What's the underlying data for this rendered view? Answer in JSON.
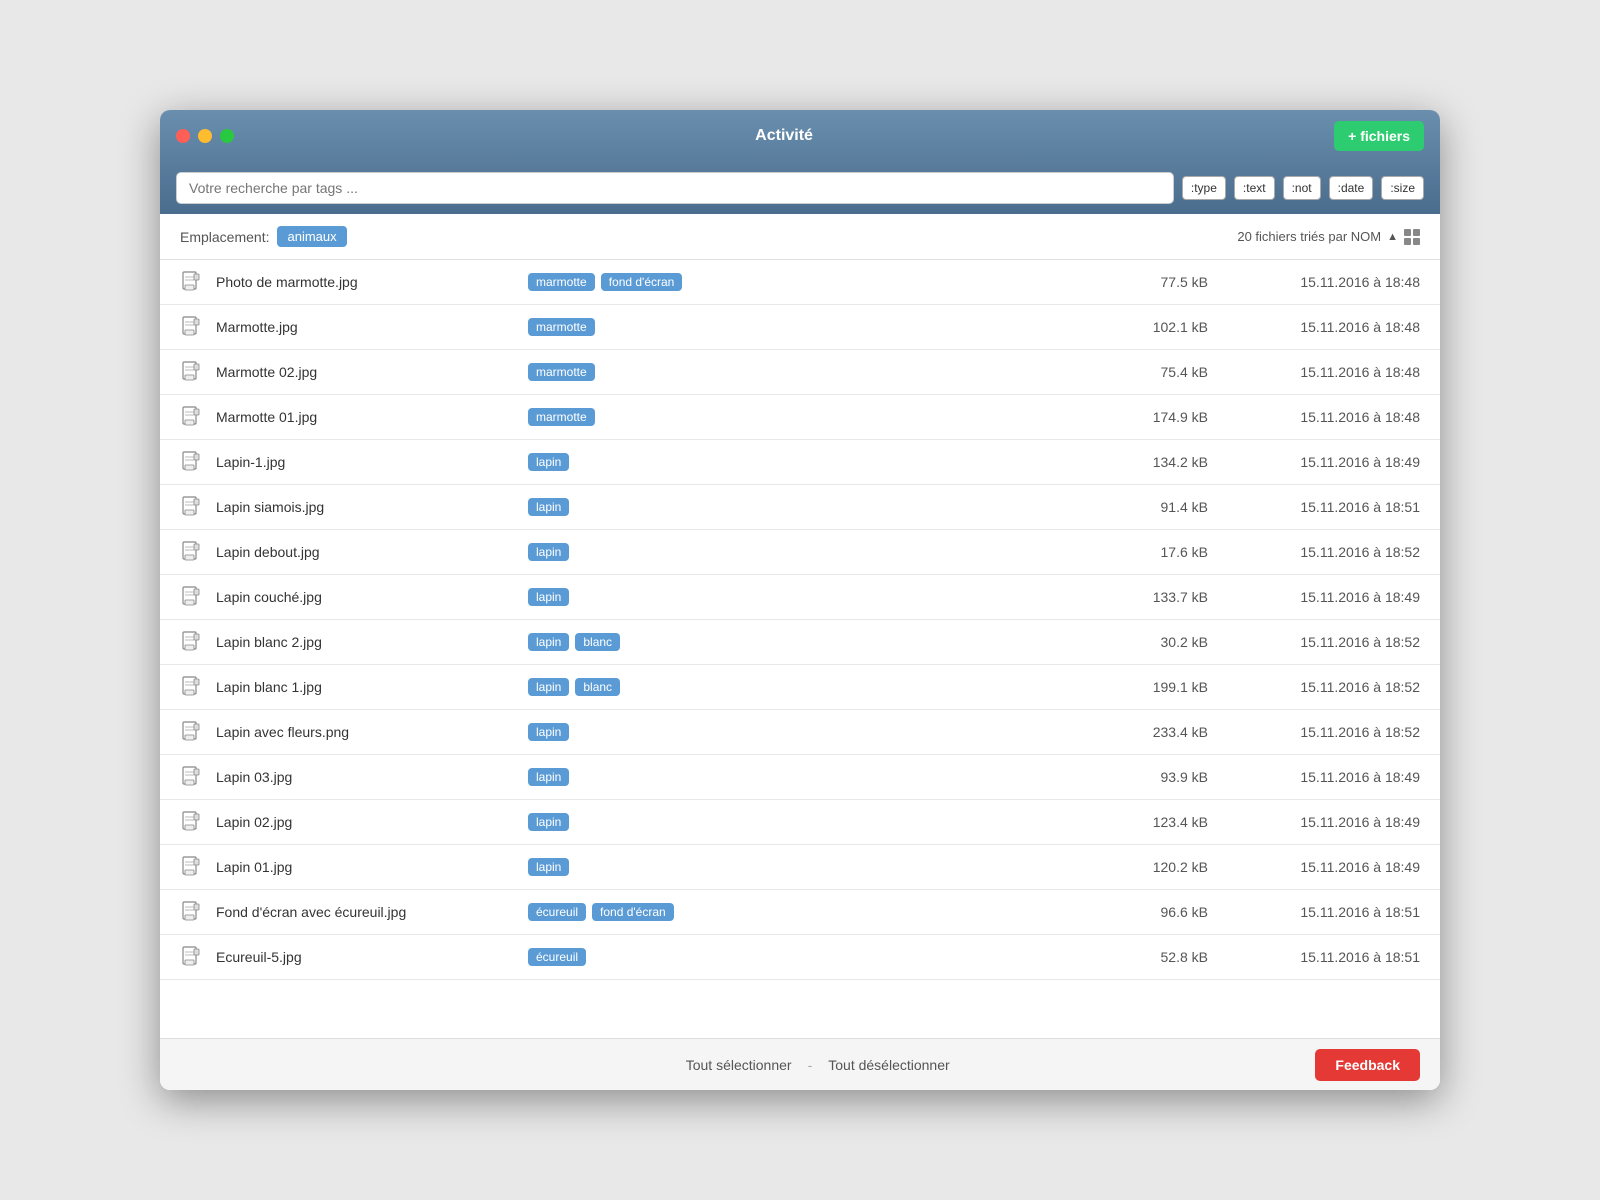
{
  "window": {
    "title": "Activité",
    "traffic": {
      "close": "close",
      "minimize": "minimize",
      "maximize": "maximize"
    },
    "add_files_label": "+ fichiers"
  },
  "search": {
    "placeholder": "Votre recherche par tags ...",
    "tag_buttons": [
      ":type",
      ":text",
      ":not",
      ":date",
      ":size"
    ]
  },
  "location": {
    "label": "Emplacement:",
    "current_tag": "animaux",
    "sort_info": "20 fichiers triés par NOM"
  },
  "files": [
    {
      "name": "Photo de marmotte.jpg",
      "tags": [
        "marmotte",
        "fond d'écran"
      ],
      "size": "77.5 kB",
      "date": "15.11.2016 à 18:48"
    },
    {
      "name": "Marmotte.jpg",
      "tags": [
        "marmotte"
      ],
      "size": "102.1 kB",
      "date": "15.11.2016 à 18:48"
    },
    {
      "name": "Marmotte 02.jpg",
      "tags": [
        "marmotte"
      ],
      "size": "75.4 kB",
      "date": "15.11.2016 à 18:48"
    },
    {
      "name": "Marmotte 01.jpg",
      "tags": [
        "marmotte"
      ],
      "size": "174.9 kB",
      "date": "15.11.2016 à 18:48"
    },
    {
      "name": "Lapin-1.jpg",
      "tags": [
        "lapin"
      ],
      "size": "134.2 kB",
      "date": "15.11.2016 à 18:49"
    },
    {
      "name": "Lapin siamois.jpg",
      "tags": [
        "lapin"
      ],
      "size": "91.4 kB",
      "date": "15.11.2016 à 18:51"
    },
    {
      "name": "Lapin debout.jpg",
      "tags": [
        "lapin"
      ],
      "size": "17.6 kB",
      "date": "15.11.2016 à 18:52"
    },
    {
      "name": "Lapin couché.jpg",
      "tags": [
        "lapin"
      ],
      "size": "133.7 kB",
      "date": "15.11.2016 à 18:49"
    },
    {
      "name": "Lapin blanc 2.jpg",
      "tags": [
        "lapin",
        "blanc"
      ],
      "size": "30.2 kB",
      "date": "15.11.2016 à 18:52"
    },
    {
      "name": "Lapin blanc 1.jpg",
      "tags": [
        "lapin",
        "blanc"
      ],
      "size": "199.1 kB",
      "date": "15.11.2016 à 18:52"
    },
    {
      "name": "Lapin avec fleurs.png",
      "tags": [
        "lapin"
      ],
      "size": "233.4 kB",
      "date": "15.11.2016 à 18:52"
    },
    {
      "name": "Lapin 03.jpg",
      "tags": [
        "lapin"
      ],
      "size": "93.9 kB",
      "date": "15.11.2016 à 18:49"
    },
    {
      "name": "Lapin 02.jpg",
      "tags": [
        "lapin"
      ],
      "size": "123.4 kB",
      "date": "15.11.2016 à 18:49"
    },
    {
      "name": "Lapin 01.jpg",
      "tags": [
        "lapin"
      ],
      "size": "120.2 kB",
      "date": "15.11.2016 à 18:49"
    },
    {
      "name": "Fond d'écran avec écureuil.jpg",
      "tags": [
        "écureuil",
        "fond d'écran"
      ],
      "size": "96.6 kB",
      "date": "15.11.2016 à 18:51"
    },
    {
      "name": "Ecureuil-5.jpg",
      "tags": [
        "écureuil"
      ],
      "size": "52.8 kB",
      "date": "15.11.2016 à 18:51"
    }
  ],
  "bottom": {
    "select_all": "Tout sélectionner",
    "separator": "-",
    "deselect_all": "Tout désélectionner",
    "feedback_label": "Feedback"
  }
}
